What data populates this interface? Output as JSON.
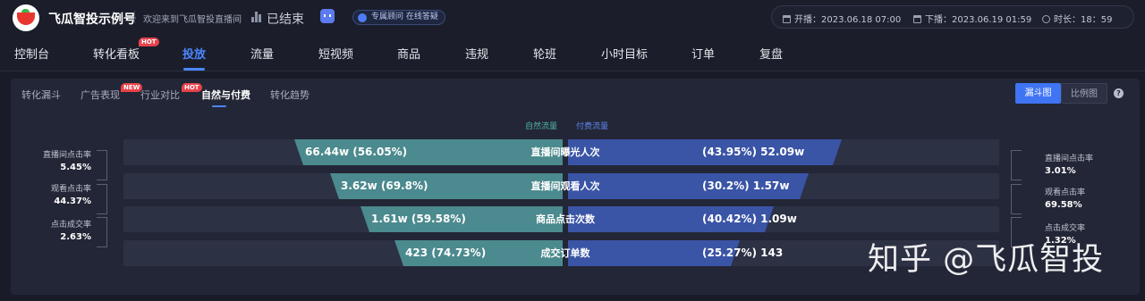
{
  "header": {
    "brand": "飞瓜智投示例号",
    "welcome": "欢迎来到飞瓜智投直播间",
    "status": "已结束",
    "consult_label": "专属顾问 在线答疑",
    "start_label": "开播：",
    "start_time": "2023.06.18 07:00",
    "end_label": "下播：",
    "end_time": "2023.06.19 01:59",
    "duration_label": "时长：",
    "duration": "18：59"
  },
  "nav": {
    "items": [
      "控制台",
      "转化看板",
      "投放",
      "流量",
      "短视频",
      "商品",
      "违规",
      "轮班",
      "小时目标",
      "订单",
      "复盘"
    ],
    "hot_badge": "HOT",
    "active": "投放"
  },
  "subtabs": {
    "items": [
      "转化漏斗",
      "广告表现",
      "行业对比",
      "自然与付费",
      "转化趋势"
    ],
    "new_badge": "NEW",
    "hot_badge": "HOT",
    "active": "自然与付费"
  },
  "view_toggle": {
    "funnel": "漏斗图",
    "ratio": "比例图",
    "active": "漏斗图"
  },
  "legend": {
    "natural": "自然流量",
    "paid": "付费流量"
  },
  "colors": {
    "natural": "#4b8a8e",
    "paid": "#3a54a6",
    "accent": "#4c86ff",
    "natural_text": "#4fb5a8",
    "paid_text": "#5c86f0"
  },
  "chart_data": {
    "type": "funnel",
    "stages": [
      {
        "label": "直播间曝光人次",
        "natural_value": "66.44w",
        "natural_pct": "(56.05%)",
        "paid_pct": "(43.95%)",
        "paid_value": "52.09w",
        "natural_share": 56.05,
        "paid_share": 43.95
      },
      {
        "label": "直播间观看人次",
        "natural_value": "3.62w",
        "natural_pct": "(69.8%)",
        "paid_pct": "(30.2%)",
        "paid_value": "1.57w",
        "natural_share": 69.8,
        "paid_share": 30.2
      },
      {
        "label": "商品点击次数",
        "natural_value": "1.61w",
        "natural_pct": "(59.58%)",
        "paid_pct": "(40.42%)",
        "paid_value": "1.09w",
        "natural_share": 59.58,
        "paid_share": 40.42
      },
      {
        "label": "成交订单数",
        "natural_value": "423",
        "natural_pct": "(74.73%)",
        "paid_pct": "(25.27%)",
        "paid_value": "143",
        "natural_share": 74.73,
        "paid_share": 25.27
      }
    ],
    "natural_rates": [
      {
        "label": "直播间点击率",
        "value": "5.45%"
      },
      {
        "label": "观看点击率",
        "value": "44.37%"
      },
      {
        "label": "点击成交率",
        "value": "2.63%"
      }
    ],
    "paid_rates": [
      {
        "label": "直播间点击率",
        "value": "3.01%"
      },
      {
        "label": "观看点击率",
        "value": "69.58%"
      },
      {
        "label": "点击成交率",
        "value": "1.32%"
      }
    ]
  },
  "watermark": "知乎 @飞瓜智投"
}
